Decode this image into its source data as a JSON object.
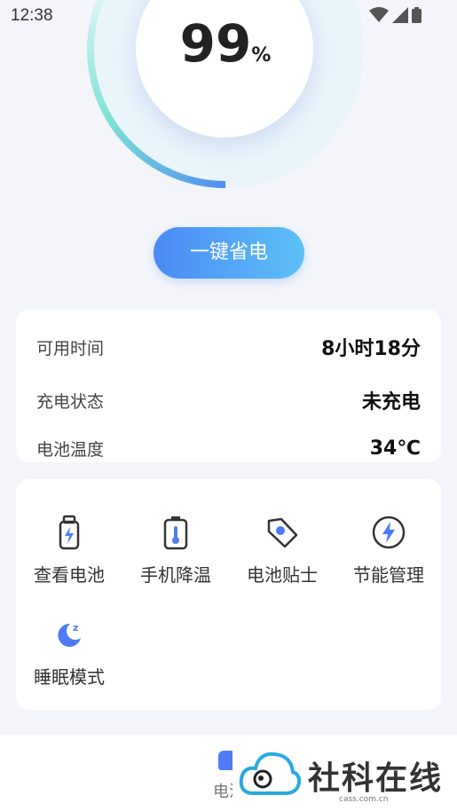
{
  "status_bar": {
    "time": "12:38"
  },
  "battery": {
    "level_number": "99",
    "level_unit": "%"
  },
  "save_button": {
    "label": "一键省电"
  },
  "info": [
    {
      "label": "可用时间",
      "value": "8小时18分"
    },
    {
      "label": "充电状态",
      "value": "未充电"
    },
    {
      "label": "电池温度",
      "value": "34℃"
    }
  ],
  "tools": [
    {
      "label": "查看电池",
      "icon": "battery-icon"
    },
    {
      "label": "手机降温",
      "icon": "thermometer-battery-icon"
    },
    {
      "label": "电池贴士",
      "icon": "tag-icon"
    },
    {
      "label": "节能管理",
      "icon": "lightning-circle-icon"
    },
    {
      "label": "睡眠模式",
      "icon": "moon-sleep-icon"
    }
  ],
  "bottom_nav": {
    "tab_label": "电池"
  },
  "watermark": {
    "title": "社科在线",
    "url": "cass.com.cn"
  },
  "colors": {
    "accent": "#4f7cf6",
    "button_start": "#4b8af5",
    "button_end": "#5dc1f7",
    "background": "#f3f5fb"
  }
}
